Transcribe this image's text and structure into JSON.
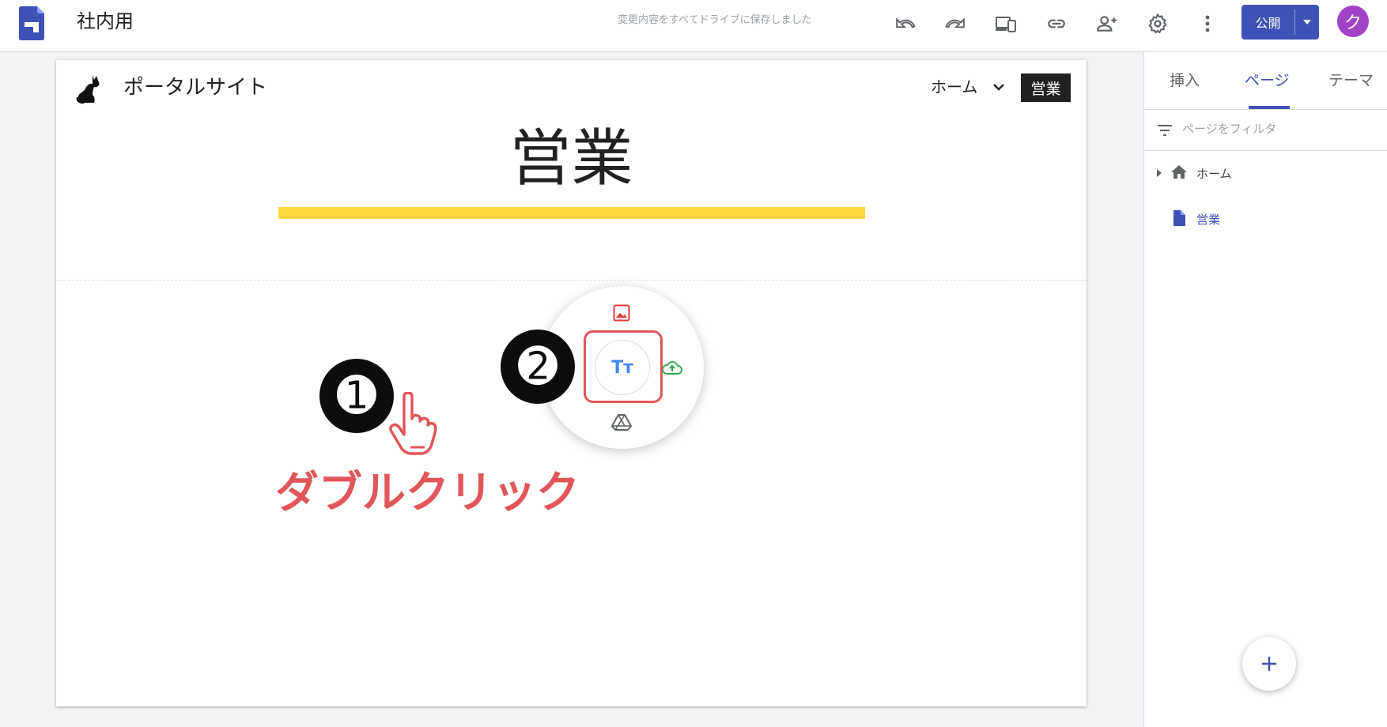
{
  "header": {
    "title": "社内用",
    "save_status": "変更内容をすべてドライブに保存しました",
    "icons": [
      "undo-icon",
      "redo-icon",
      "preview-device-icon",
      "link-icon",
      "share-person-add-icon",
      "settings-gear-icon",
      "more-vert-icon"
    ],
    "publish_label": "公開",
    "avatar_letter": "ク",
    "brand_color": "#3f51b5",
    "avatar_color": "#a142c7"
  },
  "site": {
    "name": "ポータルサイト",
    "nav": {
      "home_label": "ホーム",
      "active_label": "営業"
    },
    "heading": "営業",
    "underline_color": "#ffd740"
  },
  "insert_menu": {
    "center_label": "Tт",
    "items": [
      "image-icon",
      "text-box-icon",
      "upload-cloud-icon",
      "drive-icon"
    ]
  },
  "annotation": {
    "step1": "➊",
    "step2": "➋",
    "caption": "ダブルクリック",
    "accent_color": "#e0565b"
  },
  "side_panel": {
    "tabs": [
      "挿入",
      "ページ",
      "テーマ"
    ],
    "active_tab": "ページ",
    "filter_placeholder": "ページをフィルタ",
    "pages": [
      {
        "label": "ホーム",
        "icon": "home-icon",
        "expandable": true
      },
      {
        "label": "営業",
        "icon": "page-icon",
        "selected": true
      }
    ],
    "fab_label": "+"
  }
}
